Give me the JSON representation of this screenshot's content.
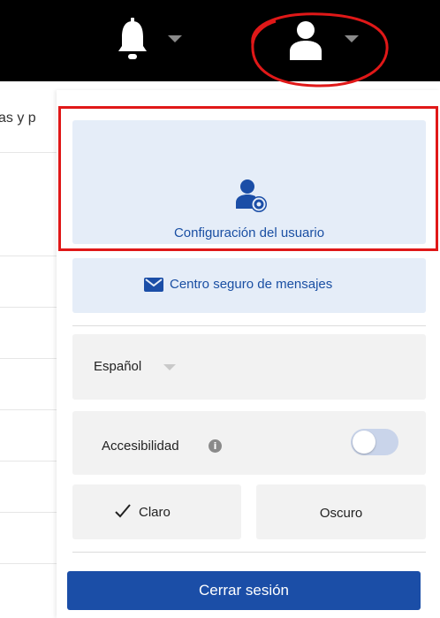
{
  "topbar": {
    "bell_icon": "bell-icon",
    "user_icon": "user-icon",
    "caret_icon": "caret-down-icon"
  },
  "background": {
    "snippet": "as y p"
  },
  "panel": {
    "user_settings": {
      "label": "Configuración del usuario",
      "icon": "user-gear-icon"
    },
    "secure_messages": {
      "label": "Centro seguro de mensajes",
      "icon": "envelope-icon"
    },
    "language": {
      "selected": "Español"
    },
    "accessibility": {
      "label": "Accesibilidad",
      "info_glyph": "i",
      "enabled": false
    },
    "theme": {
      "light_label": "Claro",
      "dark_label": "Oscuro",
      "selected": "Claro"
    },
    "logout_label": "Cerrar sesión"
  },
  "colors": {
    "accent": "#1b4ea7",
    "card_blue": "#e5edf8",
    "card_gray": "#f2f2f2",
    "annotation_red": "#e01818"
  }
}
